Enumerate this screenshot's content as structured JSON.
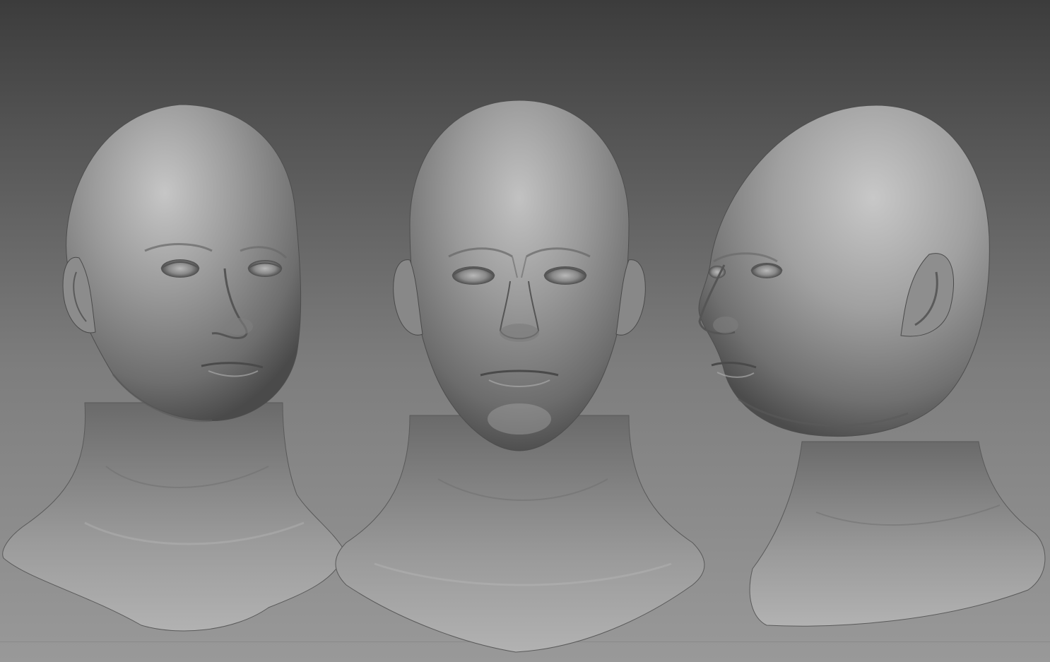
{
  "scene": {
    "background_top": "#3c3c3c",
    "background_bottom": "#999999",
    "material_base": "#8e8e8e",
    "material_highlight": "#c4c4c4",
    "material_shadow": "#3e3e3e"
  },
  "busts": [
    {
      "view": "three-quarter-left",
      "icon": "sculpt-bust"
    },
    {
      "view": "front",
      "icon": "sculpt-bust"
    },
    {
      "view": "three-quarter-right",
      "icon": "sculpt-bust"
    }
  ]
}
